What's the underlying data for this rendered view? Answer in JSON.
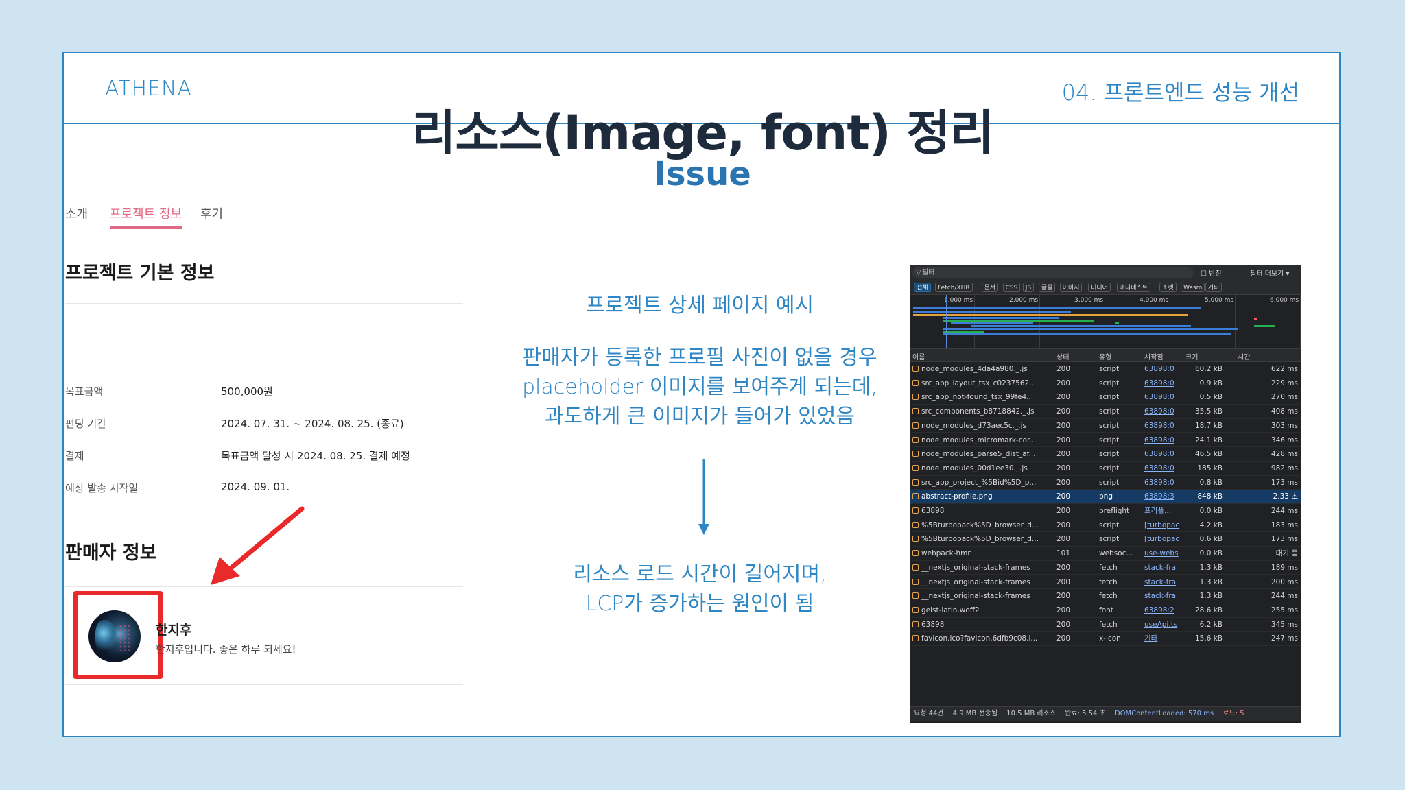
{
  "header": {
    "brand": "ATHENA",
    "section": "04. 프론트엔드 성능 개선"
  },
  "title": "리소스(Image, font) 정리",
  "subtitle": "Issue",
  "mock": {
    "tabs": [
      "소개",
      "프로젝트 정보",
      "후기"
    ],
    "active_tab": "프로젝트 정보",
    "basic_heading": "프로젝트 기본 정보",
    "info": [
      {
        "label": "목표금액",
        "value": "500,000원"
      },
      {
        "label": "펀딩 기간",
        "value": "2024. 07. 31. ~ 2024. 08. 25. (종료)"
      },
      {
        "label": "결제",
        "value": "목표금액 달성 시 2024. 08. 25. 결제 예정"
      },
      {
        "label": "예상 발송 시작일",
        "value": "2024. 09. 01."
      }
    ],
    "seller_heading": "판매자 정보",
    "seller_name": "한지후",
    "seller_desc": "한지후입니다. 좋은 하루 되세요!"
  },
  "center": {
    "line1": "프로젝트 상세 페이지 예시",
    "para1": [
      "판매자가 등록한 프로필 사진이 없을 경우",
      "placeholder 이미지를 보여주게 되는데,",
      "과도하게 큰 이미지가 들어가 있었음"
    ],
    "para2": [
      "리소스 로드 시간이 길어지며,",
      "LCP가 증가하는 원인이 됨"
    ]
  },
  "devtools": {
    "filter_placeholder": "필터",
    "invert_label": "반전",
    "more_filters": "필터 더보기 ▾",
    "types": [
      "전체",
      "Fetch/XHR",
      "문서",
      "CSS",
      "JS",
      "글꼴",
      "이미지",
      "미디어",
      "매니페스트",
      "소켓",
      "Wasm",
      "기타"
    ],
    "ticks": [
      "1,000 ms",
      "2,000 ms",
      "3,000 ms",
      "4,000 ms",
      "5,000 ms",
      "6,000 ms"
    ],
    "columns": [
      "이름",
      "상태",
      "유형",
      "시작점",
      "크기",
      "시간"
    ],
    "rows": [
      [
        "node_modules_4da4a980._.js",
        "200",
        "script",
        "63898:0",
        "60.2 kB",
        "622 ms"
      ],
      [
        "src_app_layout_tsx_c0237562...",
        "200",
        "script",
        "63898:0",
        "0.9 kB",
        "229 ms"
      ],
      [
        "src_app_not-found_tsx_99fe4...",
        "200",
        "script",
        "63898:0",
        "0.5 kB",
        "270 ms"
      ],
      [
        "src_components_b8718842._.js",
        "200",
        "script",
        "63898:0",
        "35.5 kB",
        "408 ms"
      ],
      [
        "node_modules_d73aec5c._.js",
        "200",
        "script",
        "63898:0",
        "18.7 kB",
        "303 ms"
      ],
      [
        "node_modules_micromark-cor...",
        "200",
        "script",
        "63898:0",
        "24.1 kB",
        "346 ms"
      ],
      [
        "node_modules_parse5_dist_af...",
        "200",
        "script",
        "63898:0",
        "46.5 kB",
        "428 ms"
      ],
      [
        "node_modules_00d1ee30._.js",
        "200",
        "script",
        "63898:0",
        "185 kB",
        "982 ms"
      ],
      [
        "src_app_project_%5Bid%5D_p...",
        "200",
        "script",
        "63898:0",
        "0.8 kB",
        "173 ms"
      ],
      [
        "abstract-profile.png",
        "200",
        "png",
        "63898:3",
        "848 kB",
        "2.33 초"
      ],
      [
        "63898",
        "200",
        "preflight",
        "프리플...",
        "0.0 kB",
        "244 ms"
      ],
      [
        "%5Bturbopack%5D_browser_d...",
        "200",
        "script",
        "[turbopac",
        "4.2 kB",
        "183 ms"
      ],
      [
        "%5Bturbopack%5D_browser_d...",
        "200",
        "script",
        "[turbopac",
        "0.6 kB",
        "173 ms"
      ],
      [
        "webpack-hmr",
        "101",
        "websoc...",
        "use-webs",
        "0.0 kB",
        "대기 중"
      ],
      [
        "__nextjs_original-stack-frames",
        "200",
        "fetch",
        "stack-fra",
        "1.3 kB",
        "189 ms"
      ],
      [
        "__nextjs_original-stack-frames",
        "200",
        "fetch",
        "stack-fra",
        "1.3 kB",
        "200 ms"
      ],
      [
        "__nextjs_original-stack-frames",
        "200",
        "fetch",
        "stack-fra",
        "1.3 kB",
        "244 ms"
      ],
      [
        "geist-latin.woff2",
        "200",
        "font",
        "63898:2",
        "28.6 kB",
        "255 ms"
      ],
      [
        "63898",
        "200",
        "fetch",
        "useApi.ts",
        "6.2 kB",
        "345 ms"
      ],
      [
        "favicon.ico?favicon.6dfb9c08.i...",
        "200",
        "x-icon",
        "기타",
        "15.6 kB",
        "247 ms"
      ]
    ],
    "selected_row": 9,
    "status": {
      "requests": "요청 44건",
      "transferred": "4.9 MB 전송됨",
      "resources": "10.5 MB 리소스",
      "finish": "완료: 5.54 초",
      "dcl": "DOMContentLoaded: 570 ms",
      "load": "로드: 5"
    }
  },
  "colors": {
    "accent": "#2e86c4",
    "pink": "#e36a86",
    "highlight": "#ea2a2a"
  }
}
